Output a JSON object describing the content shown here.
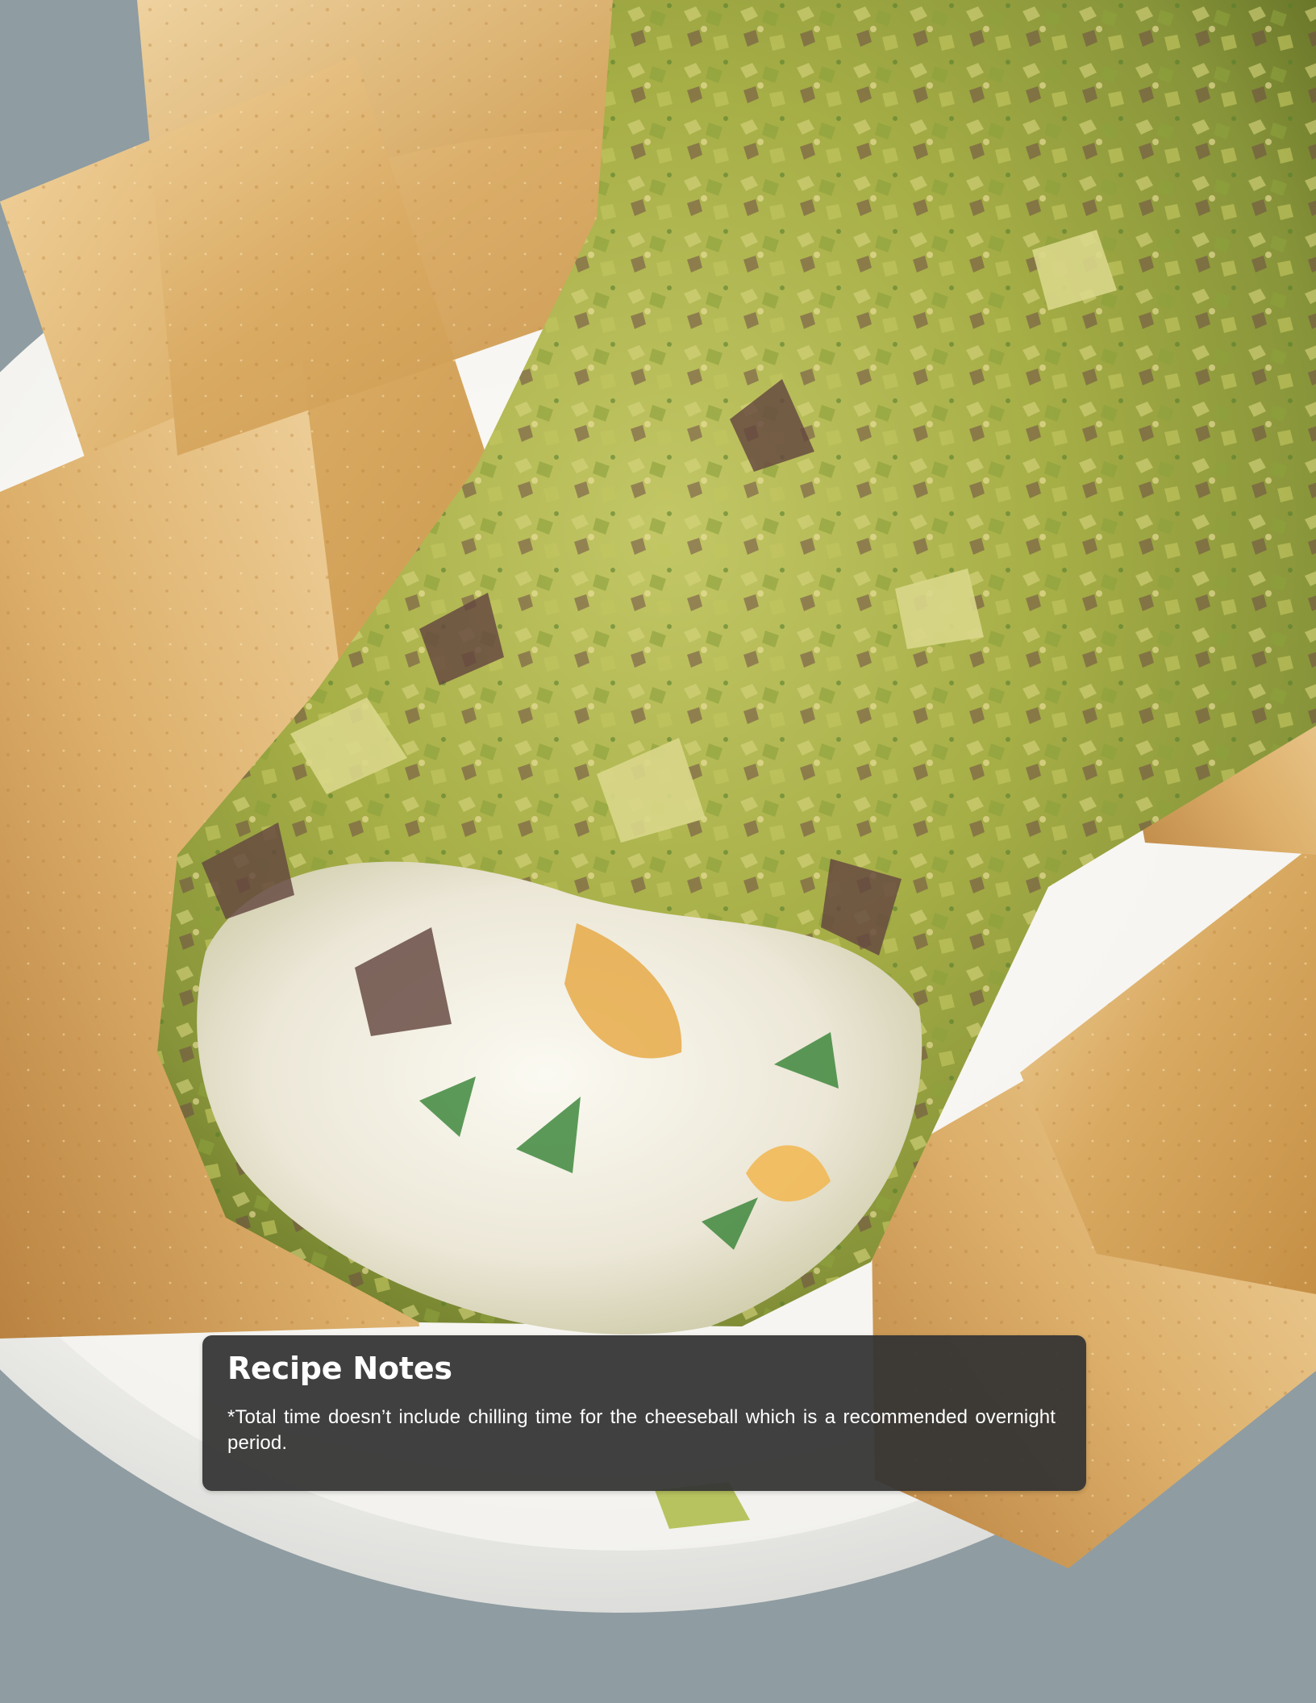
{
  "image": {
    "description_icon": "recipe-photo",
    "colors": {
      "panel": "#343434",
      "plate": "#f4f3ef",
      "pistachio": "#a8b94a",
      "cracker": "#d8b06b",
      "cheese": "#f3f0e4"
    }
  },
  "recipe_notes": {
    "title": "Recipe Notes",
    "text": "*Total time doesn’t include chilling time for the cheeseball which is a recommended overnight period."
  }
}
